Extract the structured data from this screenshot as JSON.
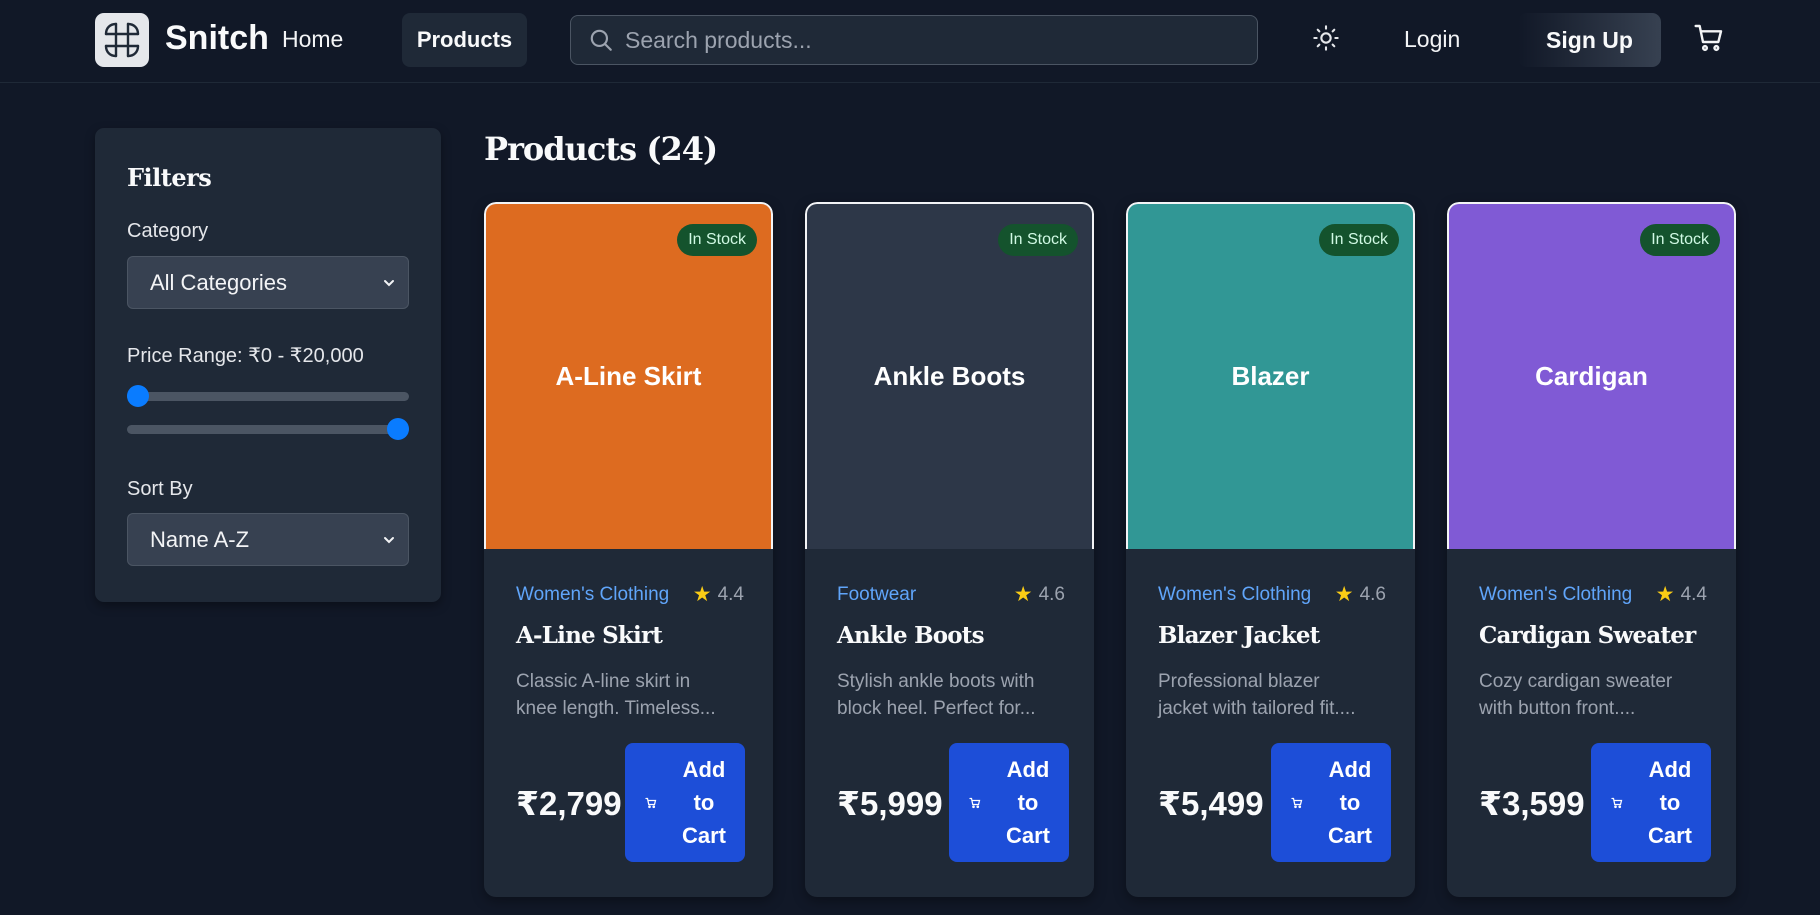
{
  "header": {
    "brand": "Snitch",
    "nav": {
      "home": "Home",
      "products": "Products"
    },
    "search_placeholder": "Search products...",
    "login": "Login",
    "signup": "Sign Up"
  },
  "filters": {
    "title": "Filters",
    "category_label": "Category",
    "category_value": "All Categories",
    "price_label": "Price Range: ₹0 - ₹20,000",
    "price_min": 0,
    "price_max": 20000,
    "sort_label": "Sort By",
    "sort_value": "Name A-Z"
  },
  "main": {
    "title": "Products (24)"
  },
  "products": [
    {
      "image_text": "A-Line Skirt",
      "image_color": "#dd6b20",
      "stock": "In Stock",
      "category": "Women's Clothing",
      "rating": "4.4",
      "name": "A-Line Skirt",
      "description_line1": "Classic A-line skirt in",
      "description_line2": "knee length. Timeless...",
      "price": "₹2,799",
      "add_l1": "Add",
      "add_l2": "to",
      "add_l3": "Cart"
    },
    {
      "image_text": "Ankle Boots",
      "image_color": "#2d3748",
      "stock": "In Stock",
      "category": "Footwear",
      "rating": "4.6",
      "name": "Ankle Boots",
      "description_line1": "Stylish ankle boots with",
      "description_line2": "block heel. Perfect for...",
      "price": "₹5,999",
      "add_l1": "Add",
      "add_l2": "to",
      "add_l3": "Cart"
    },
    {
      "image_text": "Blazer",
      "image_color": "#319795",
      "stock": "In Stock",
      "category": "Women's Clothing",
      "rating": "4.6",
      "name": "Blazer Jacket",
      "description_line1": "Professional blazer",
      "description_line2": "jacket with tailored fit....",
      "price": "₹5,499",
      "add_l1": "Add",
      "add_l2": "to",
      "add_l3": "Cart"
    },
    {
      "image_text": "Cardigan",
      "image_color": "#805ad5",
      "stock": "In Stock",
      "category": "Women's Clothing",
      "rating": "4.4",
      "name": "Cardigan Sweater",
      "description_line1": "Cozy cardigan sweater",
      "description_line2": "with button front....",
      "price": "₹3,599",
      "add_l1": "Add",
      "add_l2": "to",
      "add_l3": "Cart"
    }
  ],
  "colors": {
    "background": "#111827",
    "panel": "#1f2937",
    "accent": "#1d4ed8",
    "category_link": "#60a5fa",
    "stock_badge": "#14532d",
    "slider": "#0a7cff"
  },
  "icons": {
    "logo": "grid-knot-logo-icon",
    "search": "search-icon",
    "theme": "sun-icon",
    "cart": "cart-icon",
    "select": "chevron-down-icon",
    "rating": "star-icon"
  }
}
